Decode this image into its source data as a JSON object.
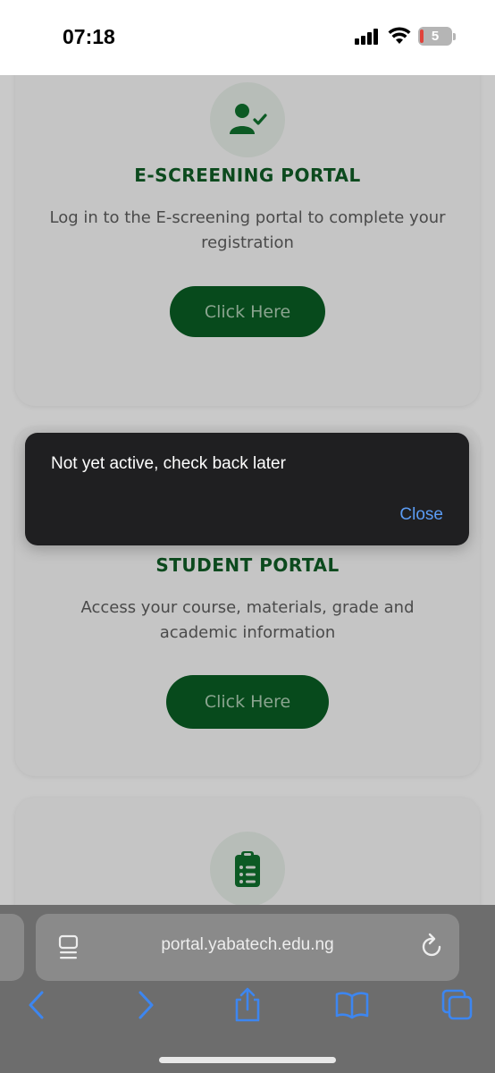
{
  "status_bar": {
    "time": "07:18",
    "battery_level": "5"
  },
  "cards": {
    "escreening": {
      "icon": "user-check-icon",
      "title": "E-SCREENING PORTAL",
      "description": "Log in to the E-screening portal to complete your registration",
      "button_label": "Click Here"
    },
    "student": {
      "title": "STUDENT PORTAL",
      "description": "Access your course, materials, grade and academic information",
      "button_label": "Click Here"
    },
    "third": {
      "icon": "clipboard-list-icon"
    }
  },
  "toast": {
    "message": "Not yet active, check back later",
    "close_label": "Close"
  },
  "browser": {
    "url": "portal.yabatech.edu.ng",
    "toolbar": [
      "back-icon",
      "forward-icon",
      "share-icon",
      "bookmarks-icon",
      "tabs-icon"
    ]
  },
  "colors": {
    "brand_green": "#0b6b2b",
    "toast_bg": "#1f1f21",
    "link_blue": "#5b9cf4"
  }
}
